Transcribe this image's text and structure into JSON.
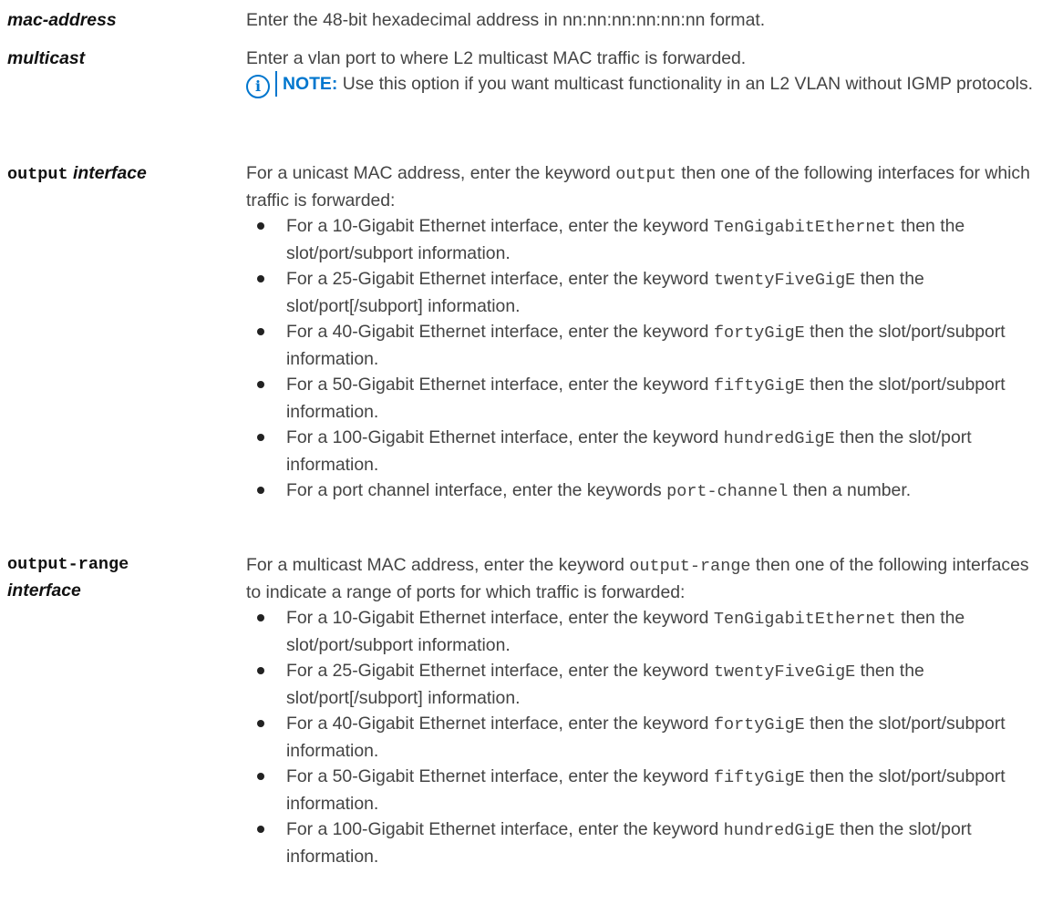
{
  "rows": {
    "mac_address": {
      "term": "mac-address",
      "desc": "Enter the 48-bit hexadecimal address in nn:nn:nn:nn:nn:nn format."
    },
    "multicast": {
      "term": "multicast",
      "desc": "Enter a vlan port to where L2 multicast MAC traffic is forwarded.",
      "note_label": "NOTE:",
      "note_text": " Use this option if you want multicast functionality in an L2 VLAN without IGMP protocols."
    },
    "output": {
      "term_kw": "output",
      "term_arg": "interface",
      "intro_a": "For a unicast MAC address, enter the keyword ",
      "intro_kw": "output",
      "intro_b": " then one of the following interfaces for which traffic is forwarded:",
      "bullets": [
        {
          "a": "For a 10-Gigabit Ethernet interface, enter the keyword ",
          "kw": "TenGigabitEthernet",
          "b": " then the slot/port/subport information."
        },
        {
          "a": "For a 25-Gigabit Ethernet interface, enter the keyword ",
          "kw": "twentyFiveGigE",
          "b": " then the slot/port[/subport] information."
        },
        {
          "a": "For a 40-Gigabit Ethernet interface, enter the keyword ",
          "kw": "fortyGigE",
          "b": " then the slot/port/subport information."
        },
        {
          "a": "For a 50-Gigabit Ethernet interface, enter the keyword ",
          "kw": "fiftyGigE",
          "b": " then the slot/port/subport information."
        },
        {
          "a": "For a 100-Gigabit Ethernet interface, enter the keyword ",
          "kw": "hundredGigE",
          "b": " then the slot/port information."
        },
        {
          "a": "For a port channel interface, enter the keywords ",
          "kw": "port-channel",
          "b": " then a number."
        }
      ]
    },
    "output_range": {
      "term_kw": "output-range",
      "term_arg": "interface",
      "intro_a": "For a multicast MAC address, enter the keyword ",
      "intro_kw": "output-range",
      "intro_b": " then one of the following interfaces to indicate a range of ports for which traffic is forwarded:",
      "bullets": [
        {
          "a": "For a 10-Gigabit Ethernet interface, enter the keyword ",
          "kw": "TenGigabitEthernet",
          "b": " then the slot/port/subport information."
        },
        {
          "a": "For a 25-Gigabit Ethernet interface, enter the keyword ",
          "kw": "twentyFiveGigE",
          "b": " then the slot/port[/subport] information."
        },
        {
          "a": "For a 40-Gigabit Ethernet interface, enter the keyword ",
          "kw": "fortyGigE",
          "b": " then the slot/port/subport information."
        },
        {
          "a": "For a 50-Gigabit Ethernet interface, enter the keyword ",
          "kw": "fiftyGigE",
          "b": " then the slot/port/subport information."
        },
        {
          "a": "For a 100-Gigabit Ethernet interface, enter the keyword ",
          "kw": "hundredGigE",
          "b": " then the slot/port information."
        }
      ]
    }
  },
  "colors": {
    "note_accent": "#0076ce",
    "text": "#444444"
  },
  "icons": {
    "note": "info-icon"
  }
}
